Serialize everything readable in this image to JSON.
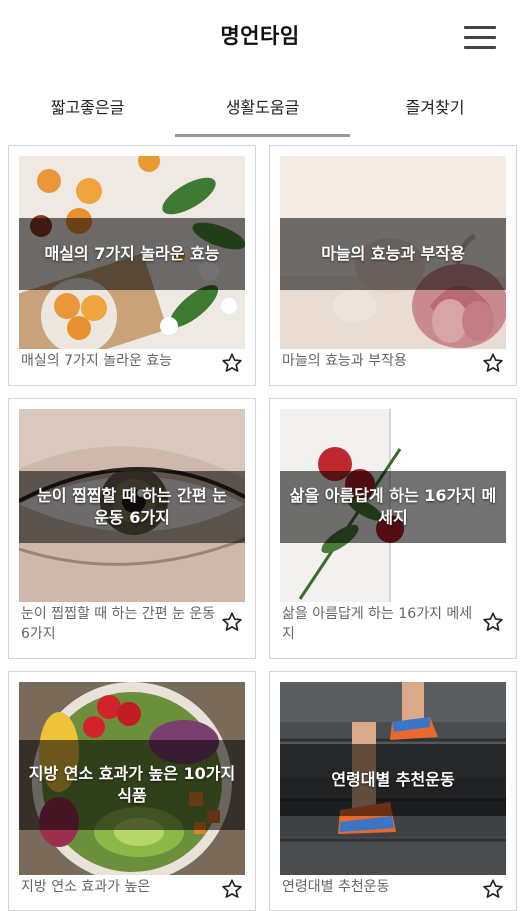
{
  "app": {
    "title": "명언타임",
    "menu_icon": "hamburger-menu-icon"
  },
  "tabs": [
    {
      "label": "짧고좋은글",
      "active": false
    },
    {
      "label": "생활도움글",
      "active": true
    },
    {
      "label": "즐겨찾기",
      "active": false
    }
  ],
  "cards": [
    {
      "overlay_title": "매실의 7가지 놀라운 효능",
      "caption": "매실의 7가지 놀라운 효능",
      "favorite_icon": "star-outline-icon",
      "image": "apricots-and-flowers"
    },
    {
      "overlay_title": "마늘의 효능과 부작용",
      "caption": "마늘의 효능과 부작용",
      "favorite_icon": "star-outline-icon",
      "image": "garlic-bulb"
    },
    {
      "overlay_title": "눈이 찝찝할 때 하는 간편 눈 운동 6가지",
      "caption": "눈이 찝찝할 때 하는 간편 눈 운동 6가지",
      "favorite_icon": "star-outline-icon",
      "image": "eye-closeup"
    },
    {
      "overlay_title": "삶을 아름답게 하는 16가지 메세지",
      "caption": "삶을 아름답게 하는 16가지 메세지",
      "favorite_icon": "star-outline-icon",
      "image": "red-rose-on-book"
    },
    {
      "overlay_title": "지방 연소 효과가 높은 10가지 식품",
      "caption": "지방 연소 효과가 높은",
      "favorite_icon": "star-outline-icon",
      "image": "salad-bowl"
    },
    {
      "overlay_title": "연령대별 추천운동",
      "caption": "연령대별 추천운동",
      "favorite_icon": "star-outline-icon",
      "image": "runner-on-stairs"
    }
  ]
}
